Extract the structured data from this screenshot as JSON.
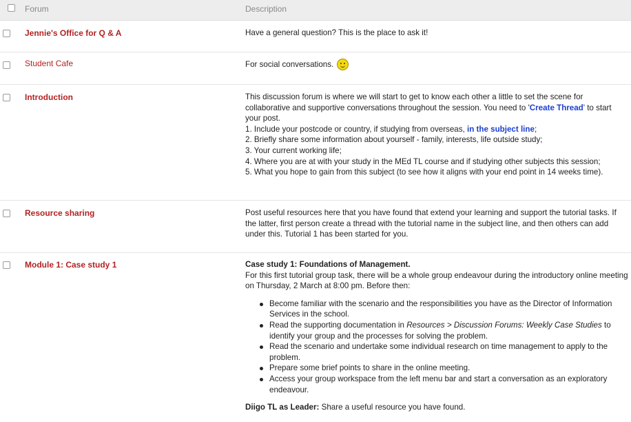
{
  "header": {
    "forum_label": "Forum",
    "description_label": "Description"
  },
  "rows": [
    {
      "name": "Jennie's Office for Q & A",
      "desc": "Have a general question? This is the place to ask it!"
    },
    {
      "name": "Student Cafe",
      "desc": "For social conversations.",
      "icon": "smiley-icon"
    },
    {
      "name": "Introduction",
      "desc_a": "This discussion forum is where we will start to get to know each other a little to set the scene for collaborative and supportive conversations throughout the session. You need to '",
      "desc_link": "Create Thread",
      "desc_b": "' to start your post.",
      "item1_a": "1. Include your postcode or country, if studying from overseas,",
      "item1_link": "in the subject line",
      "item1_b": ";",
      "item2": "2. Briefly share some information about yourself - family, interests, life outside study;",
      "item3": "3. Your current  working life;",
      "item4": "4. Where you are at with your study in the MEd TL course and if studying other subjects this session;",
      "item5": "5. What you hope to gain from this subject (to see how it aligns with your end point in 14 weeks time)."
    },
    {
      "name": "Resource sharing",
      "desc": "Post useful resources here that you have found that extend your learning and support the tutorial tasks. If the latter, first person create a thread with the tutorial name in the subject line, and then others can add under this. Tutorial 1 has been started for you."
    },
    {
      "name": "Module 1: Case study 1",
      "heading": "Case study 1: Foundations of Management.",
      "intro": "For this first tutorial group task, there will be a whole group endeavour during the introductory online meeting on Thursday, 2 March at 8:00 pm. Before then:",
      "bullets": [
        "Become familiar with the scenario and the responsibilities you have as the Director of Information Services in the school.",
        "Read the supporting documentation in",
        "Read the scenario and undertake some individual research on time management to apply to the problem.",
        "Prepare some brief points to share in the online meeting.",
        "Access your group workspace from the left menu bar and start a conversation as an exploratory endeavour."
      ],
      "bullet2_italic": "Resources > Discussion Forums: Weekly Case Studies",
      "bullet2_tail": "to identify your group and the processes for solving the problem.",
      "diigo_label": "Diigo TL as Leader:",
      "diigo_text": "Share a useful resource you have found."
    }
  ]
}
